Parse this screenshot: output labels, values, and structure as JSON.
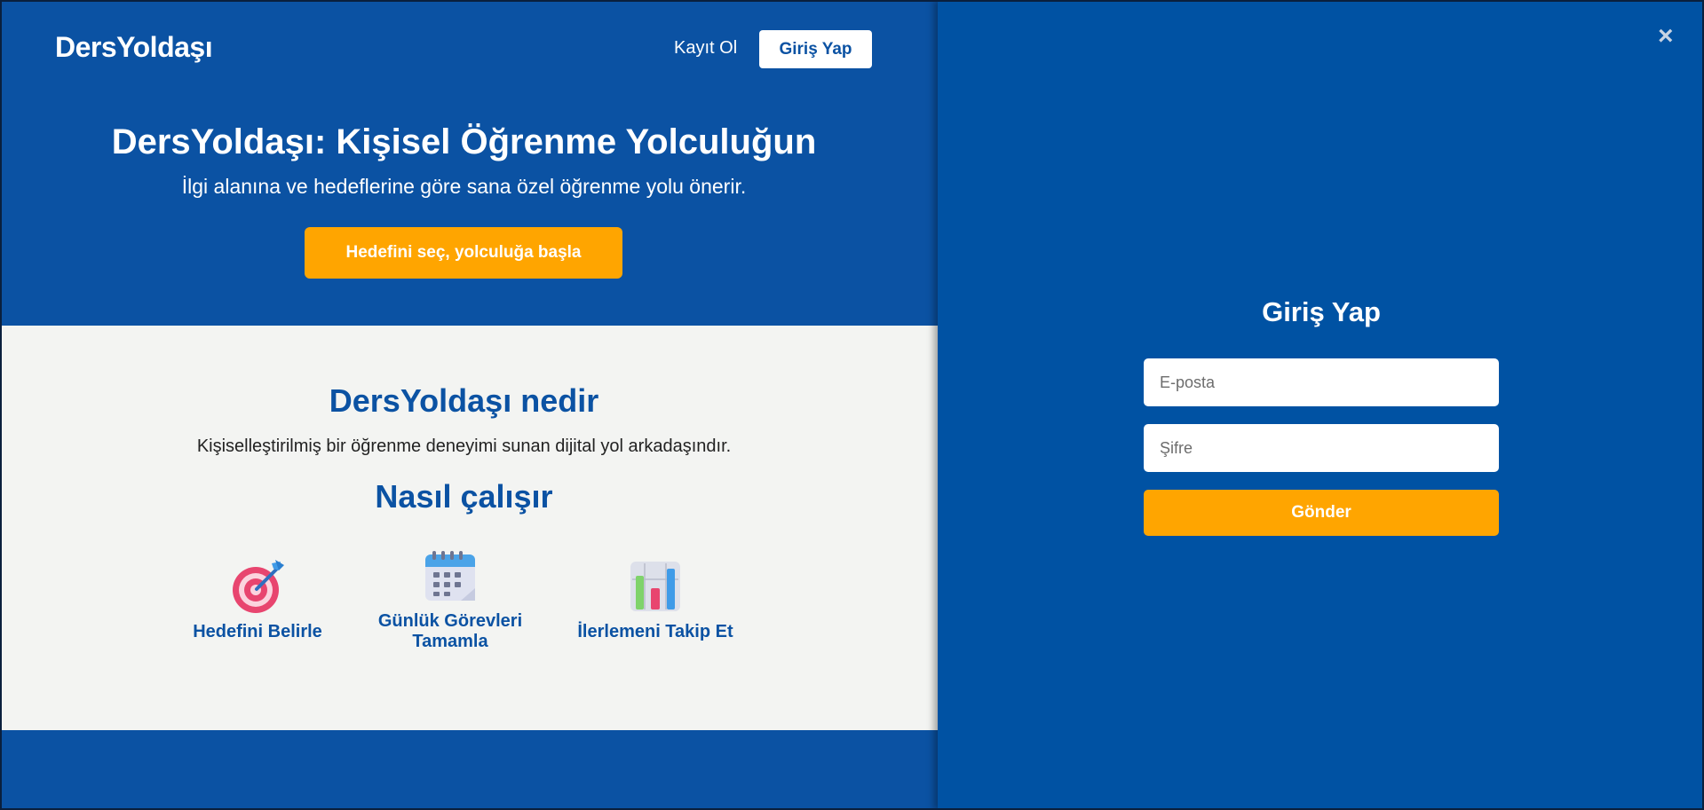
{
  "header": {
    "logo": "DersYoldaşı",
    "register_label": "Kayıt Ol",
    "login_label": "Giriş Yap"
  },
  "hero": {
    "title": "DersYoldaşı: Kişisel Öğrenme Yolculuğun",
    "subtitle": "İlgi alanına ve hedeflerine göre sana özel öğrenme yolu önerir.",
    "cta_label": "Hedefini seç, yolculuğa başla"
  },
  "about": {
    "title": "DersYoldaşı nedir",
    "description": "Kişiselleştirilmiş bir öğrenme deneyimi sunan dijital yol arkadaşındır.",
    "how_title": "Nasıl çalışır",
    "steps": [
      {
        "label": "Hedefini Belirle",
        "icon": "target-icon"
      },
      {
        "label": "Günlük Görevleri Tamamla",
        "icon": "calendar-icon"
      },
      {
        "label": "İlerlemeni Takip Et",
        "icon": "bar-chart-icon"
      }
    ]
  },
  "login_panel": {
    "close_label": "×",
    "title": "Giriş Yap",
    "email_placeholder": "E-posta",
    "email_value": "",
    "password_placeholder": "Şifre",
    "password_value": "",
    "submit_label": "Gönder"
  },
  "colors": {
    "primary": "#0b52a3",
    "accent": "#ffa500",
    "section_bg": "#f3f4f2"
  }
}
